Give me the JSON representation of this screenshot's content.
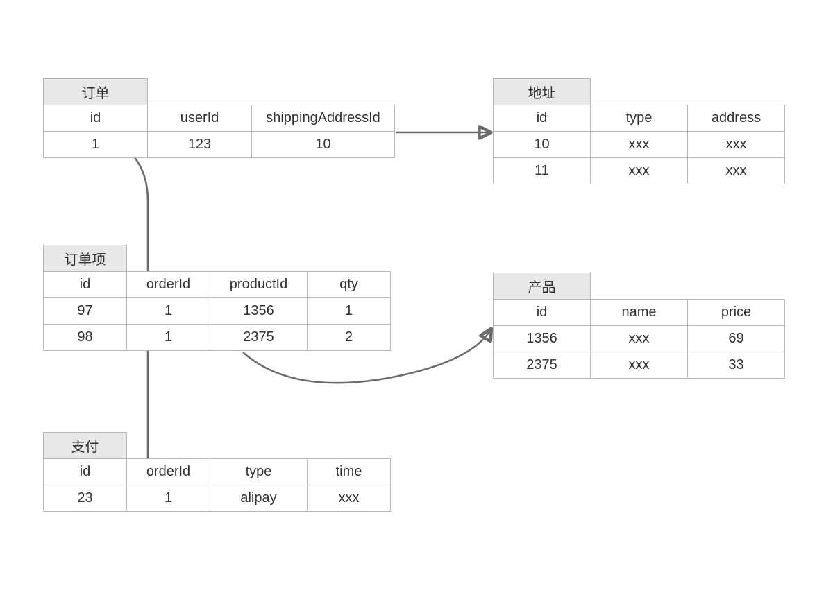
{
  "order": {
    "title": "订单",
    "columns": [
      "id",
      "userId",
      "shippingAddressId"
    ],
    "rows": [
      [
        "1",
        "123",
        "10"
      ]
    ]
  },
  "address": {
    "title": "地址",
    "columns": [
      "id",
      "type",
      "address"
    ],
    "rows": [
      [
        "10",
        "xxx",
        "xxx"
      ],
      [
        "11",
        "xxx",
        "xxx"
      ]
    ]
  },
  "orderItem": {
    "title": "订单项",
    "columns": [
      "id",
      "orderId",
      "productId",
      "qty"
    ],
    "rows": [
      [
        "97",
        "1",
        "1356",
        "1"
      ],
      [
        "98",
        "1",
        "2375",
        "2"
      ]
    ]
  },
  "product": {
    "title": "产品",
    "columns": [
      "id",
      "name",
      "price"
    ],
    "rows": [
      [
        "1356",
        "xxx",
        "69"
      ],
      [
        "2375",
        "xxx",
        "33"
      ]
    ]
  },
  "payment": {
    "title": "支付",
    "columns": [
      "id",
      "orderId",
      "type",
      "time"
    ],
    "rows": [
      [
        "23",
        "1",
        "alipay",
        "xxx"
      ]
    ]
  }
}
